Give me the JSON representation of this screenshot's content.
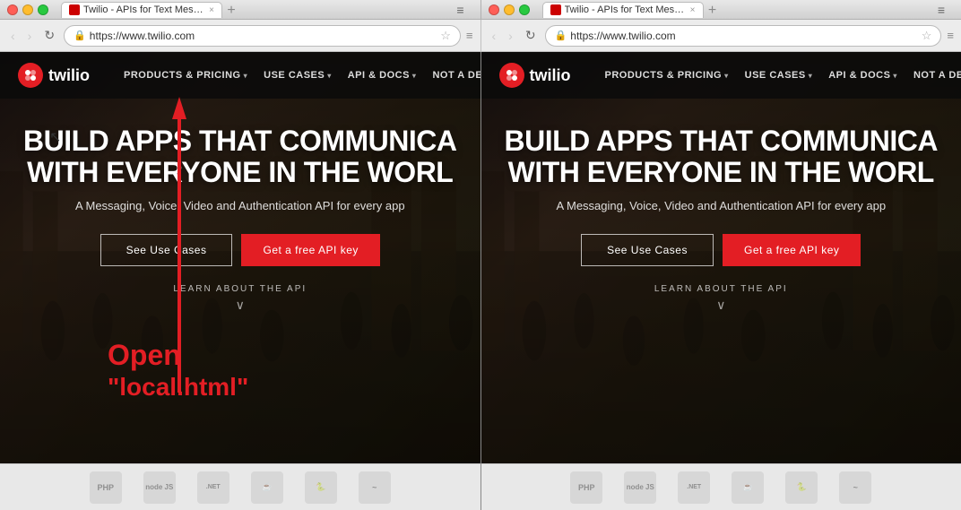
{
  "left_browser": {
    "tab": {
      "title": "Twilio - APIs for Text Mess...",
      "favicon_color": "#cc0000"
    },
    "url": "https://www.twilio.com",
    "nav": {
      "logo_text": "twilio",
      "links": [
        {
          "label": "PRODUCTS & PRICING",
          "has_arrow": true
        },
        {
          "label": "USE CASES",
          "has_arrow": true
        },
        {
          "label": "API & DOCS",
          "has_arrow": true
        },
        {
          "label": "NOT A DEVELOPER?",
          "has_arrow": false
        }
      ]
    },
    "hero": {
      "title_line1": "BUILD APPS THAT COMMUNICA",
      "title_line2": "WITH EVERYONE IN THE WORL",
      "subtitle": "A Messaging, Voice, Video and Authentication API for every app",
      "btn_use_cases": "See Use Cases",
      "btn_api": "Get a free API key",
      "learn_label": "LEARN ABOUT THE API"
    }
  },
  "right_browser": {
    "tab": {
      "title": "Twilio - APIs for Text Mess...",
      "favicon_color": "#cc0000"
    },
    "url": "https://www.twilio.com",
    "nav": {
      "logo_text": "twilio",
      "links": [
        {
          "label": "PRODUCTS & PRICING",
          "has_arrow": true
        },
        {
          "label": "USE CASES",
          "has_arrow": true
        },
        {
          "label": "API & DOCS",
          "has_arrow": true
        },
        {
          "label": "NOT A DEVELOPER?",
          "has_arrow": false
        }
      ]
    },
    "hero": {
      "title_line1": "BUILD APPS THAT COMMUNICA",
      "title_line2": "WITH EVERYONE IN THE WORL",
      "subtitle": "A Messaging, Voice, Video and Authentication API for every app",
      "btn_use_cases": "See Use Cases",
      "btn_api": "Get a free API key",
      "learn_label": "LEARN ABOUT THE API"
    }
  },
  "annotation": {
    "line1": "Open",
    "line2": "\"local.html\""
  },
  "logos_bar": [
    {
      "text": "PHP"
    },
    {
      "text": "node\nJS"
    },
    {
      "text": "Microsoft\n.NET"
    },
    {
      "text": "Java"
    },
    {
      "text": "Python"
    },
    {
      "text": "~"
    }
  ],
  "nav_buttons": {
    "back": "‹",
    "forward": "›",
    "reload": "↻"
  }
}
